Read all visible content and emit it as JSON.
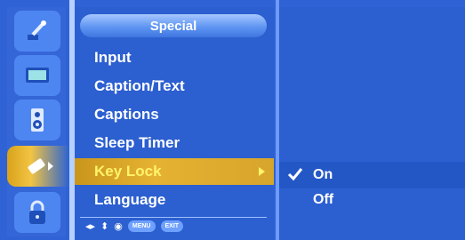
{
  "menu": {
    "title": "Special",
    "items": [
      {
        "label": "Input"
      },
      {
        "label": "Caption/Text"
      },
      {
        "label": "Captions"
      },
      {
        "label": "Sleep Timer"
      },
      {
        "label": "Key Lock",
        "selected": true
      },
      {
        "label": "Language"
      }
    ]
  },
  "submenu": {
    "items": [
      {
        "label": "On",
        "checked": true
      },
      {
        "label": "Off",
        "checked": false
      }
    ]
  },
  "hints": {
    "menu_label": "MENU",
    "exit_label": "EXIT"
  },
  "sidebar": {
    "icons": [
      "satellite-icon",
      "tv-screen-icon",
      "speaker-icon",
      "special-key-icon",
      "lock-icon"
    ],
    "active_index": 3
  },
  "colors": {
    "background": "#2f62d4",
    "selected_bar": "#e6b233",
    "selected_text": "#fff36a",
    "text": "#ffffff"
  }
}
